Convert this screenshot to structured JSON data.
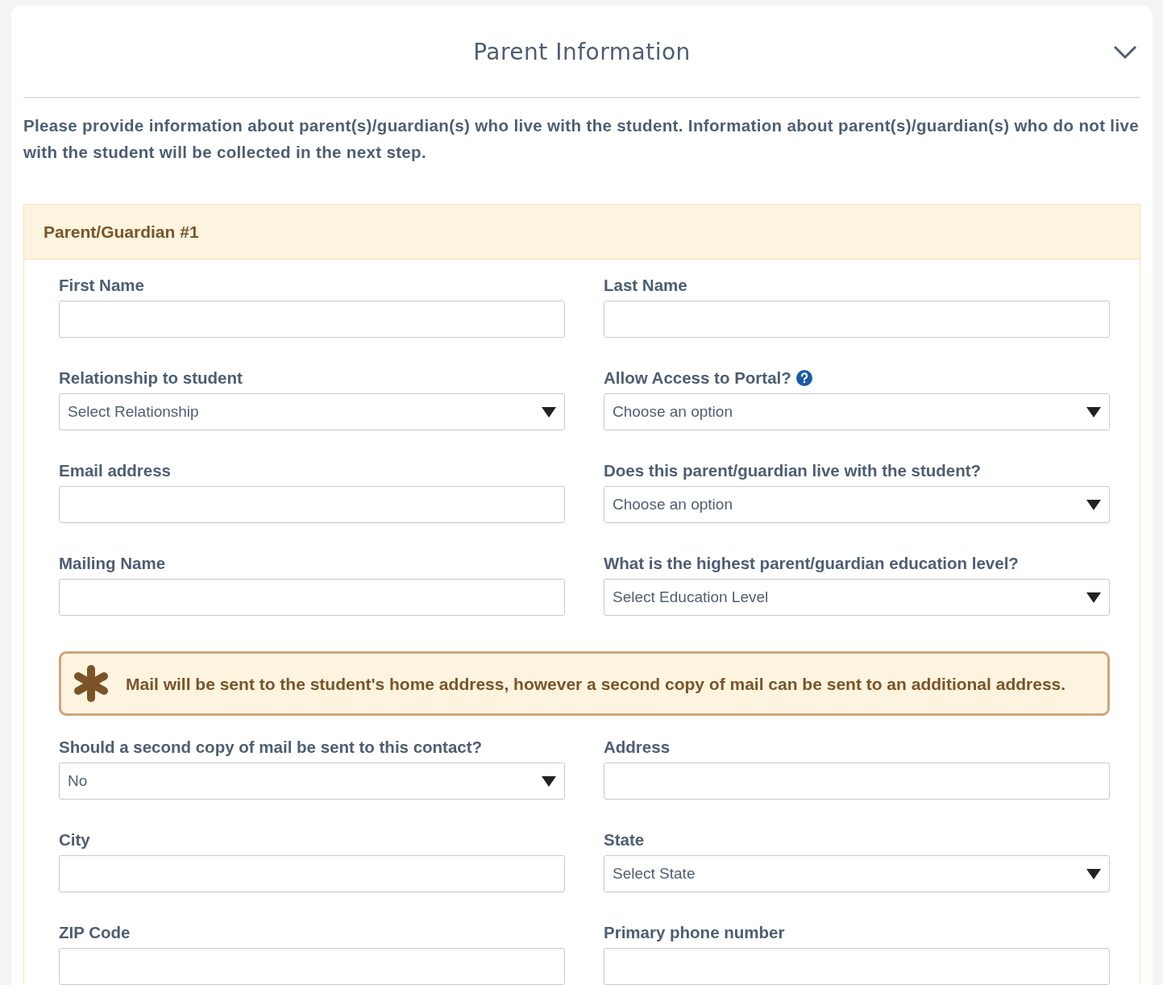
{
  "panel": {
    "title": "Parent Information",
    "expanded": true,
    "intro": "Please provide information about parent(s)/guardian(s) who live with the student.  Information about parent(s)/guardian(s) who do not live with the student will be collected in the next step.",
    "section": {
      "title": "Parent/Guardian #1",
      "fields_top": [
        {
          "kind": "text",
          "label": "First Name"
        },
        {
          "kind": "text",
          "label": "Last Name"
        },
        {
          "kind": "select",
          "label": "Relationship to student",
          "value": "Select Relationship"
        },
        {
          "kind": "select",
          "label": "Allow Access to Portal?",
          "value": "Choose an option",
          "help": true
        },
        {
          "kind": "text",
          "label": "Email address"
        },
        {
          "kind": "select",
          "label": "Does this parent/guardian live with the student?",
          "value": "Choose an option"
        },
        {
          "kind": "text",
          "label": "Mailing Name"
        },
        {
          "kind": "select",
          "label": "What is the highest parent/guardian education level?",
          "value": "Select Education Level"
        }
      ],
      "notice": "Mail will be sent to the student's home address, however a second copy of mail can be sent to an additional address.",
      "fields_bottom": [
        {
          "kind": "select",
          "label": "Should a second copy of mail be sent to this contact?",
          "value": "No"
        },
        {
          "kind": "text",
          "label": "Address"
        },
        {
          "kind": "text",
          "label": "City"
        },
        {
          "kind": "select",
          "label": "State",
          "value": "Select State"
        },
        {
          "kind": "text",
          "label": "ZIP Code"
        },
        {
          "kind": "text",
          "label": "Primary phone number"
        }
      ]
    }
  }
}
